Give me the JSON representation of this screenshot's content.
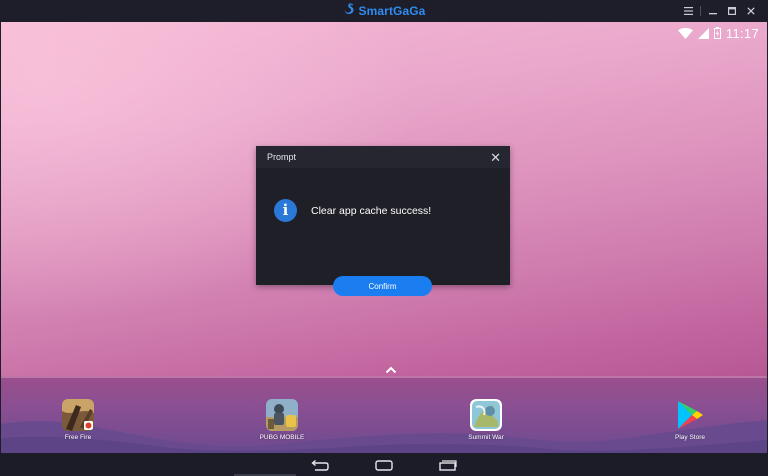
{
  "window": {
    "brand": "SmartGaGa",
    "controls": [
      "menu",
      "minimize",
      "maximize",
      "close"
    ]
  },
  "status_bar": {
    "time": "11:17",
    "icons": [
      "wifi-icon",
      "cell-signal-icon",
      "battery-icon"
    ]
  },
  "dialog": {
    "title": "Prompt",
    "close_glyph": "✕",
    "message": "Clear app cache success!",
    "confirm_label": "Confirm",
    "icon": "info-icon"
  },
  "dock": {
    "apps": [
      {
        "label": "Free Fire"
      },
      {
        "label": "PUBG MOBILE"
      },
      {
        "label": "Summit War"
      },
      {
        "label": "Play Store"
      }
    ]
  },
  "navigation": [
    "back-icon",
    "home-icon",
    "recents-icon"
  ],
  "colors": {
    "accent": "#1a7ef0",
    "brand": "#2f8cf0",
    "chrome": "#1d1e29"
  }
}
